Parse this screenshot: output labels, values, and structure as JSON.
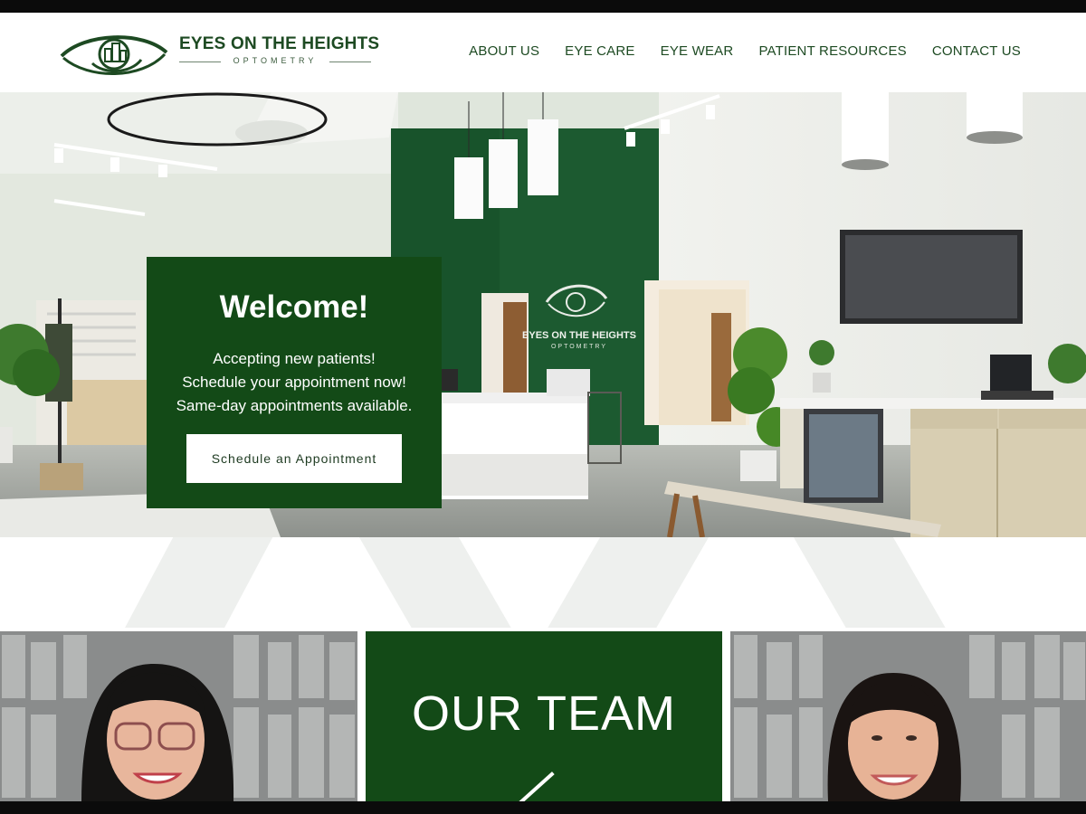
{
  "brand": {
    "name": "EYES ON THE HEIGHTS",
    "tagline": "OPTOMETRY",
    "primary_color": "#134a17",
    "text_color": "#1d4a22"
  },
  "nav": {
    "items": [
      {
        "label": "ABOUT US"
      },
      {
        "label": "EYE CARE"
      },
      {
        "label": "EYE WEAR"
      },
      {
        "label": "PATIENT RESOURCES"
      },
      {
        "label": "CONTACT US"
      }
    ]
  },
  "hero": {
    "title": "Welcome!",
    "lines": [
      "Accepting new patients!",
      "Schedule your appointment now!",
      "Same-day appointments available."
    ],
    "cta_label": "Schedule an Appointment",
    "wall_sign_name": "EYES ON THE HEIGHTS",
    "wall_sign_sub": "OPTOMETRY"
  },
  "team": {
    "heading": "OUR TEAM"
  }
}
